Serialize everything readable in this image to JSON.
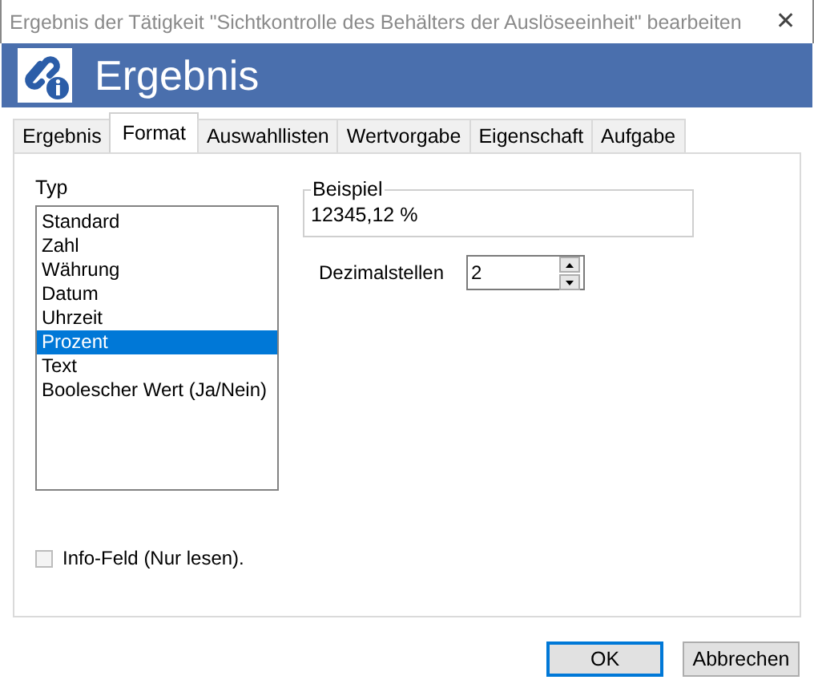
{
  "window": {
    "title": "Ergebnis der Tätigkeit \"Sichtkontrolle des Behälters der Auslöseeinheit\" bearbeiten",
    "close": "✕"
  },
  "banner": {
    "title": "Ergebnis"
  },
  "tabs": [
    {
      "label": "Ergebnis",
      "selected": false
    },
    {
      "label": "Format",
      "selected": true
    },
    {
      "label": "Auswahllisten",
      "selected": false
    },
    {
      "label": "Wertvorgabe",
      "selected": false
    },
    {
      "label": "Eigenschaft",
      "selected": false
    },
    {
      "label": "Aufgabe",
      "selected": false
    }
  ],
  "type_list": {
    "label": "Typ",
    "items": [
      {
        "label": "Standard",
        "selected": false
      },
      {
        "label": "Zahl",
        "selected": false
      },
      {
        "label": "Währung",
        "selected": false
      },
      {
        "label": "Datum",
        "selected": false
      },
      {
        "label": "Uhrzeit",
        "selected": false
      },
      {
        "label": "Prozent",
        "selected": true
      },
      {
        "label": "Text",
        "selected": false
      },
      {
        "label": "Boolescher Wert (Ja/Nein)",
        "selected": false
      }
    ]
  },
  "example": {
    "label": "Beispiel",
    "value": "12345,12 %"
  },
  "decimals": {
    "label": "Dezimalstellen",
    "value": "2"
  },
  "info_field": {
    "label": "Info-Feld (Nur lesen).",
    "checked": false
  },
  "buttons": [
    {
      "label": "OK",
      "default": true
    },
    {
      "label": "Abbrechen",
      "default": false
    }
  ]
}
